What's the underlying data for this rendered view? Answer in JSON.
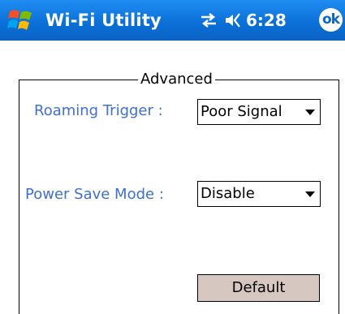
{
  "titlebar": {
    "app_title": "Wi-Fi Utility",
    "clock": "6:28",
    "ok_label": "ok",
    "start_icon": "windows-flag-icon",
    "connectivity_icon": "connectivity-icon",
    "volume_icon": "speaker-icon",
    "background": "#0a6fd6"
  },
  "advanced": {
    "legend": "Advanced",
    "roaming_trigger": {
      "label": "Roaming Trigger :",
      "value": "Poor Signal"
    },
    "power_save_mode": {
      "label": "Power Save Mode :",
      "value": "Disable"
    },
    "default_button_label": "Default"
  },
  "colors": {
    "label_text": "#3f6fd0",
    "button_face": "#d6c8c1"
  }
}
